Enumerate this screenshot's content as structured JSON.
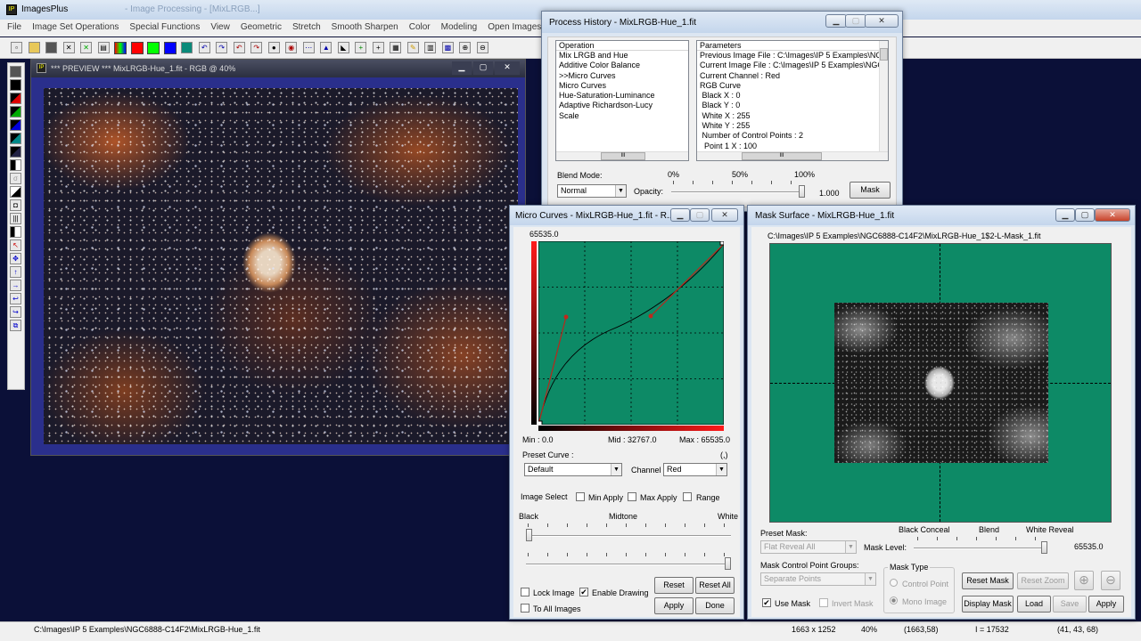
{
  "app": {
    "title": "ImagesPlus",
    "title_suffix": "- Image Processing - [MixLRGB...]",
    "menu": [
      "File",
      "Image Set Operations",
      "Special Functions",
      "View",
      "Geometric",
      "Stretch",
      "Smooth Sharpen",
      "Color",
      "Modeling",
      "Open Images",
      "Op"
    ],
    "statusbar": {
      "path": "C:\\Images\\IP 5 Examples\\NGC6888-C14F2\\MixLRGB-Hue_1.fit",
      "dims": "1663 x 1252",
      "zoom": "40%",
      "coords": "(1663,58)",
      "intensity": "I = 17532",
      "rgb": "(41, 43, 68)"
    }
  },
  "preview": {
    "title": "*** PREVIEW *** MixLRGB-Hue_1.fit - RGB @ 40%"
  },
  "process_history": {
    "title": "Process History - MixLRGB-Hue_1.fit",
    "operation_header": "Operation",
    "operations": [
      "Mix LRGB and Hue",
      "Additive Color Balance",
      ">>Micro Curves",
      "Micro Curves",
      "Hue-Saturation-Luminance",
      "Adaptive Richardson-Lucy",
      "Scale"
    ],
    "parameters_header": "Parameters",
    "parameters": [
      "Previous Image File : C:\\Images\\IP 5 Examples\\NGC",
      "Current Image File : C:\\Images\\IP 5 Examples\\NGC6",
      "Current Channel : Red",
      "RGB Curve",
      " Black X : 0",
      " Black Y : 0",
      " White X : 255",
      " White Y : 255",
      " Number of Control Points : 2",
      "  Point 1 X : 100"
    ],
    "blend_mode_label": "Blend Mode:",
    "blend_mode_value": "Normal",
    "opacity_label": "Opacity:",
    "pct_0": "0%",
    "pct_50": "50%",
    "pct_100": "100%",
    "opacity_value": "1.000",
    "opacity_level": 1.0,
    "mask_button": "Mask"
  },
  "micro_curves": {
    "title": "Micro Curves - MixLRGB-Hue_1.fit - R...",
    "max_value": "65535.0",
    "min_label": "Min :",
    "min_value": "0.0",
    "mid_label": "Mid :",
    "mid_value": "32767.0",
    "max_label": "Max :",
    "max_value_bottom": "65535.0",
    "preset_curve_label": "Preset Curve :",
    "preset_curve_value": "Default",
    "coord_readout": "(,)",
    "channel_label": "Channel",
    "channel_value": "Red",
    "image_select_label": "Image Select",
    "min_apply": "Min Apply",
    "max_apply": "Max Apply",
    "range": "Range",
    "black": "Black",
    "midtone": "Midtone",
    "white": "White",
    "slider1_level": 0.0,
    "slider2_level": 1.0,
    "lock_image": "Lock Image",
    "enable_drawing": "Enable Drawing",
    "enable_drawing_checked": "✔",
    "to_all_images": "To All Images",
    "reset": "Reset",
    "reset_all": "Reset All",
    "apply": "Apply",
    "done": "Done",
    "colors": {
      "plot_bg": "#0d8a66",
      "curve": "#000000",
      "control": "#c0281c"
    }
  },
  "mask_surface": {
    "title": "Mask Surface - MixLRGB-Hue_1.fit",
    "path": "C:\\Images\\IP 5 Examples\\NGC6888-C14F2\\MixLRGB-Hue_1$2-L-Mask_1.fit",
    "black_conceal": "Black Conceal",
    "blend": "Blend",
    "white_reveal": "White Reveal",
    "preset_mask_label": "Preset Mask:",
    "preset_mask_value": "Flat Reveal All",
    "mask_level_label": "Mask Level:",
    "mask_level_value": "65535.0",
    "mask_level": 1.0,
    "groups_label": "Mask Control Point Groups:",
    "groups_value": "Separate Points",
    "mask_type_label": "Mask Type",
    "control_point": "Control Point",
    "mono_image": "Mono Image",
    "use_mask": "Use Mask",
    "use_mask_checked": "✔",
    "invert_mask": "Invert Mask",
    "reset_mask": "Reset Mask",
    "reset_zoom": "Reset Zoom",
    "display_mask": "Display Mask",
    "load": "Load",
    "save": "Save",
    "apply": "Apply"
  }
}
